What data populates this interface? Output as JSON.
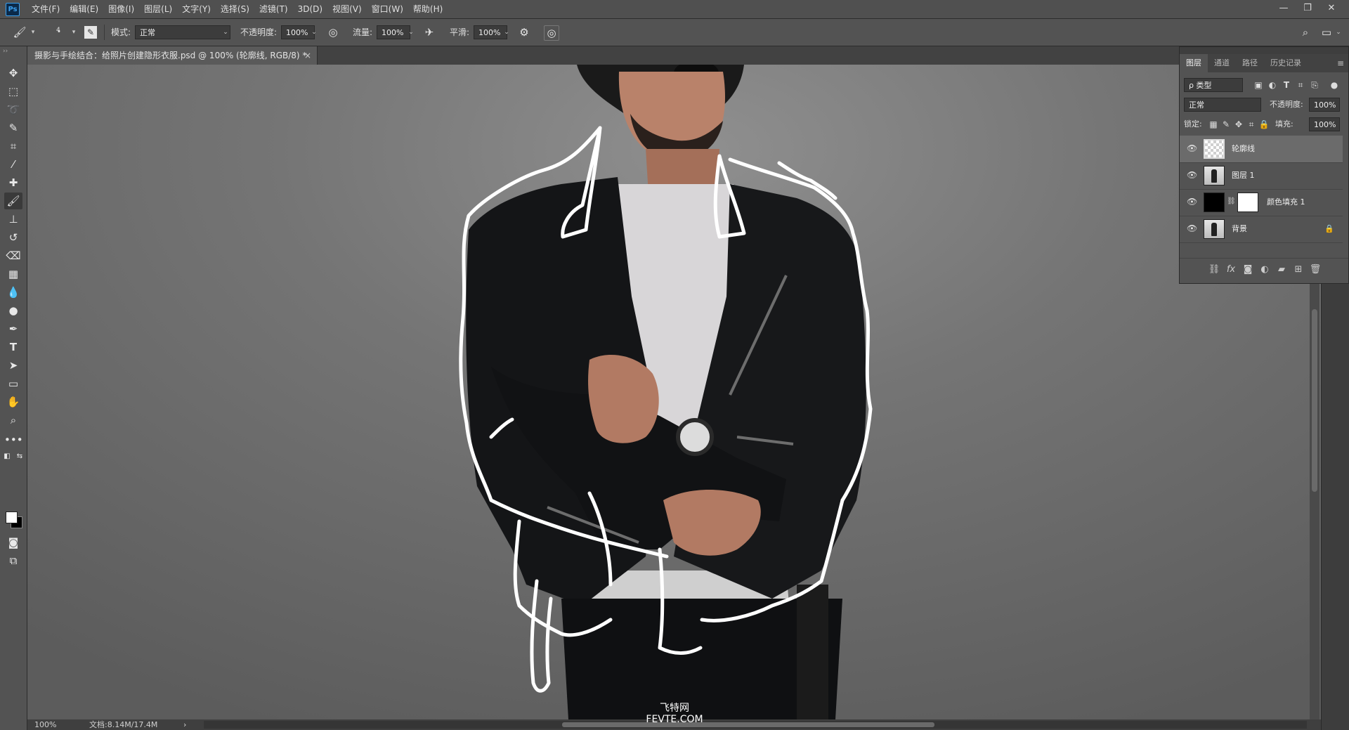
{
  "app": {
    "logo": "Ps"
  },
  "menu": [
    "文件(F)",
    "编辑(E)",
    "图像(I)",
    "图层(L)",
    "文字(Y)",
    "选择(S)",
    "滤镜(T)",
    "3D(D)",
    "视图(V)",
    "窗口(W)",
    "帮助(H)"
  ],
  "window_controls": [
    "—",
    "❐",
    "✕"
  ],
  "options": {
    "brush_size": "4",
    "mode_label": "模式:",
    "mode_value": "正常",
    "opacity_label": "不透明度:",
    "opacity_value": "100%",
    "flow_label": "流量:",
    "flow_value": "100%",
    "smooth_label": "平滑:",
    "smooth_value": "100%"
  },
  "document": {
    "tab_title": "摄影与手绘结合：给照片创建隐形衣服.psd @ 100% (轮廓线, RGB/8) *",
    "close": "×"
  },
  "status": {
    "zoom": "100%",
    "doc_size": "文档:8.14M/17.4M",
    "arrow": "›"
  },
  "layers_panel": {
    "tabs": [
      "图层",
      "通道",
      "路径",
      "历史记录"
    ],
    "active_tab": 0,
    "filter_label": "ρ 类型",
    "blend_mode": "正常",
    "opacity_label": "不透明度:",
    "opacity_value": "100%",
    "lock_label": "锁定:",
    "fill_label": "填充:",
    "fill_value": "100%",
    "layers": [
      {
        "name": "轮廓线",
        "thumb": "transparent",
        "visible": true,
        "selected": true
      },
      {
        "name": "图层 1",
        "thumb": "photo",
        "visible": true,
        "selected": false
      },
      {
        "name": "颜色填充 1",
        "thumb": "fill-black",
        "visible": true,
        "selected": false
      },
      {
        "name": "背景",
        "thumb": "photo",
        "visible": true,
        "selected": false,
        "locked": true
      }
    ]
  },
  "watermark": {
    "cn": "飞特网",
    "en": "FEVTE.COM"
  },
  "colors": {
    "foreground": "#ffffff",
    "background": "#000000"
  }
}
